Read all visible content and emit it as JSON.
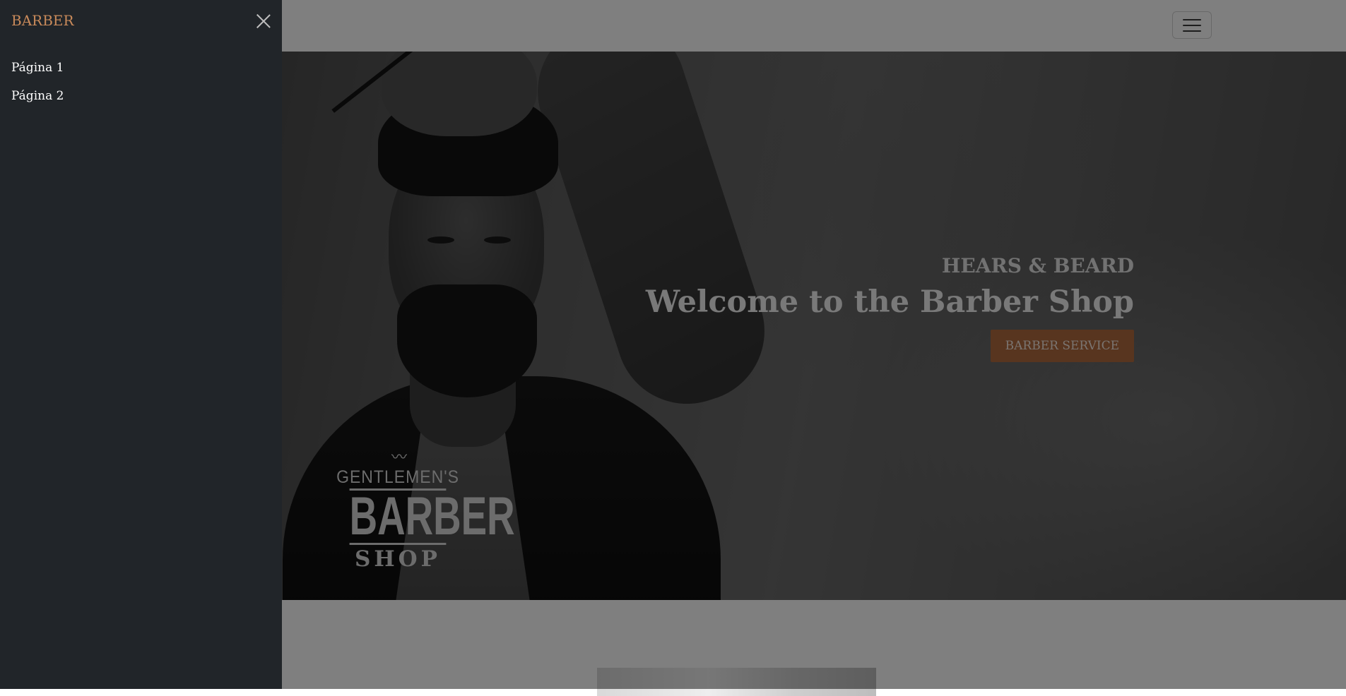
{
  "offcanvas": {
    "title": "BARBER",
    "nav_items": [
      {
        "label": "Página 1"
      },
      {
        "label": "Página 2"
      }
    ],
    "close_icon": "close-icon"
  },
  "navbar": {
    "toggler_icon": "hamburger-icon"
  },
  "hero": {
    "subtitle": "HEARS & BEARD",
    "title": "Welcome to the Barber Shop",
    "button_label": "BARBER SERVICE",
    "logo": {
      "top": "GENTLEMEN'S",
      "main": "BARBER",
      "bottom": "SHOP"
    }
  },
  "colors": {
    "offcanvas_bg": "#212529",
    "brand": "#c98a5a",
    "button": "#b06a3e"
  }
}
